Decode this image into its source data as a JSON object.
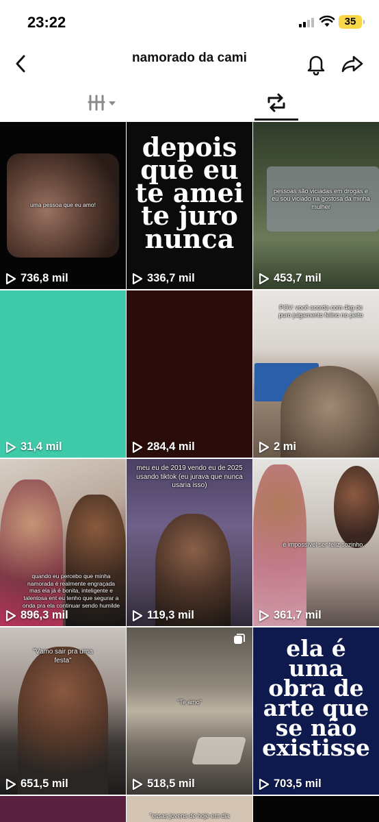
{
  "status_bar": {
    "time": "23:22",
    "battery": "35"
  },
  "header": {
    "title": "namorado da cami"
  },
  "tabs": [
    {
      "name": "videos-grid"
    },
    {
      "name": "reposts"
    }
  ],
  "videos": [
    {
      "views": "736,8 mil",
      "caption": "uma pessoa que eu amo!"
    },
    {
      "views": "336,7 mil",
      "big_text": "depois que eu te amei te juro nunca"
    },
    {
      "views": "453,7 mil",
      "caption": "pessoas são viciadas em drogas e eu sou viciado na gostosa da minha mulher"
    },
    {
      "views": "31,4 mil"
    },
    {
      "views": "284,4 mil"
    },
    {
      "views": "2 mi",
      "caption": "POV: você acorda com 4kg de puro julgamento felino no peito"
    },
    {
      "views": "896,3 mil",
      "caption": "quando eu percebo que minha namorada é realmente engraçada mas ela já é bonita, inteligente e talentosa ent eu tenho que segurar a onda pra ela continuar sendo humilde"
    },
    {
      "views": "119,3 mil",
      "caption": "meu eu de 2019 vendo eu de 2025 usando tiktok (eu jurava que nunca usaria isso)"
    },
    {
      "views": "361,7 mil",
      "caption": "é impossível ser feliz sozinho."
    },
    {
      "views": "651,5 mil",
      "caption": "\"Vamo sair pra uma festa\""
    },
    {
      "views": "518,5 mil",
      "caption": "\"Te amo\""
    },
    {
      "views": "703,5 mil",
      "big_text": "ela é uma obra de arte que se não existisse"
    }
  ],
  "partial_row": {
    "caption": "\"essas jovens de hoje em dia"
  },
  "colors": {
    "teal": "#3fcba9",
    "maroon": "#2a0d0a",
    "navy": "#0e1a4d"
  }
}
